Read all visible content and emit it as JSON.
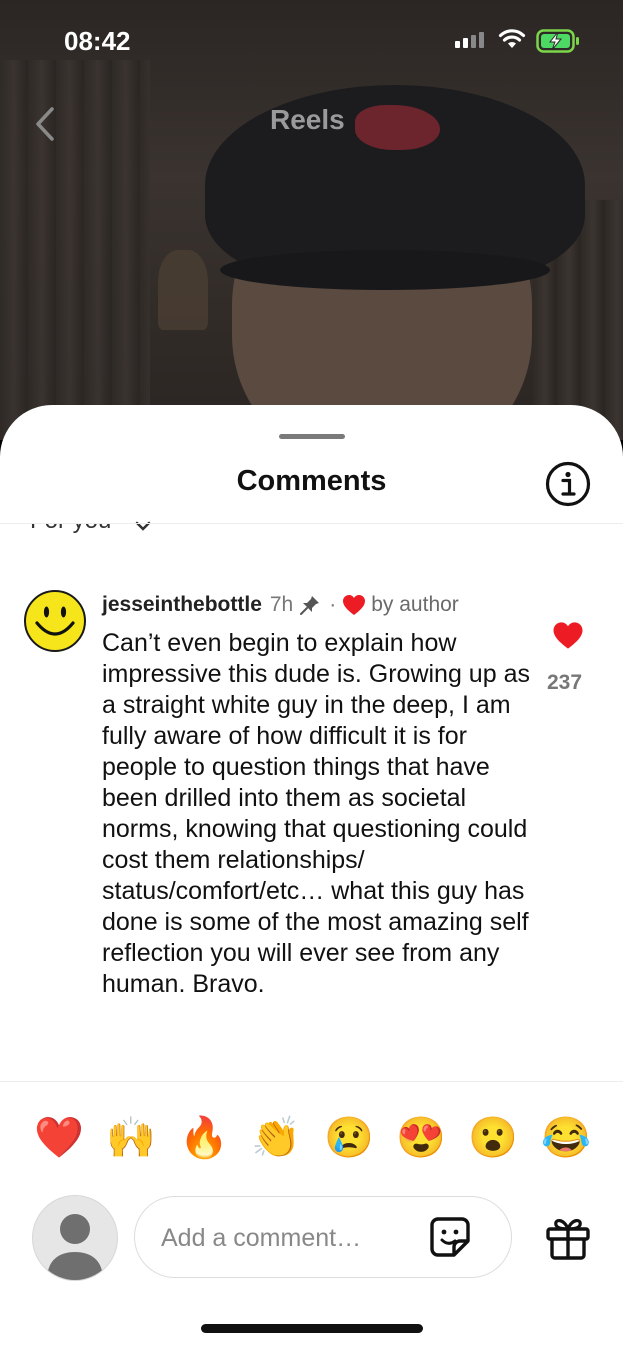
{
  "status_bar": {
    "time": "08:42"
  },
  "nav": {
    "title": "Reels"
  },
  "sheet": {
    "title": "Comments",
    "sort_label": "For you"
  },
  "comment": {
    "username": "jesseinthebottle",
    "time_ago": "7h",
    "liked_by_label": "by author",
    "text": "Can’t even begin to explain how impressive this dude is. Growing up as a straight white guy in the deep, I am fully aware of how difficult it is for people to question things that have been drilled into them as societal norms, knowing that questioning could cost them relationships/ status/comfort/etc… what this guy has done is some of the most amazing self reflection you will ever see from any human. Bravo.",
    "like_count": "237",
    "heart_color": "#ed1c24"
  },
  "quick_reactions": [
    "❤️",
    "🙌",
    "🔥",
    "👏",
    "😢",
    "😍",
    "😮",
    "😂"
  ],
  "composer": {
    "placeholder": "Add a comment…",
    "value": ""
  },
  "icons": {
    "back": "chevron-left-icon",
    "info": "info-icon",
    "pin": "pin-icon",
    "sticker": "sticker-icon",
    "gift": "gift-icon"
  }
}
